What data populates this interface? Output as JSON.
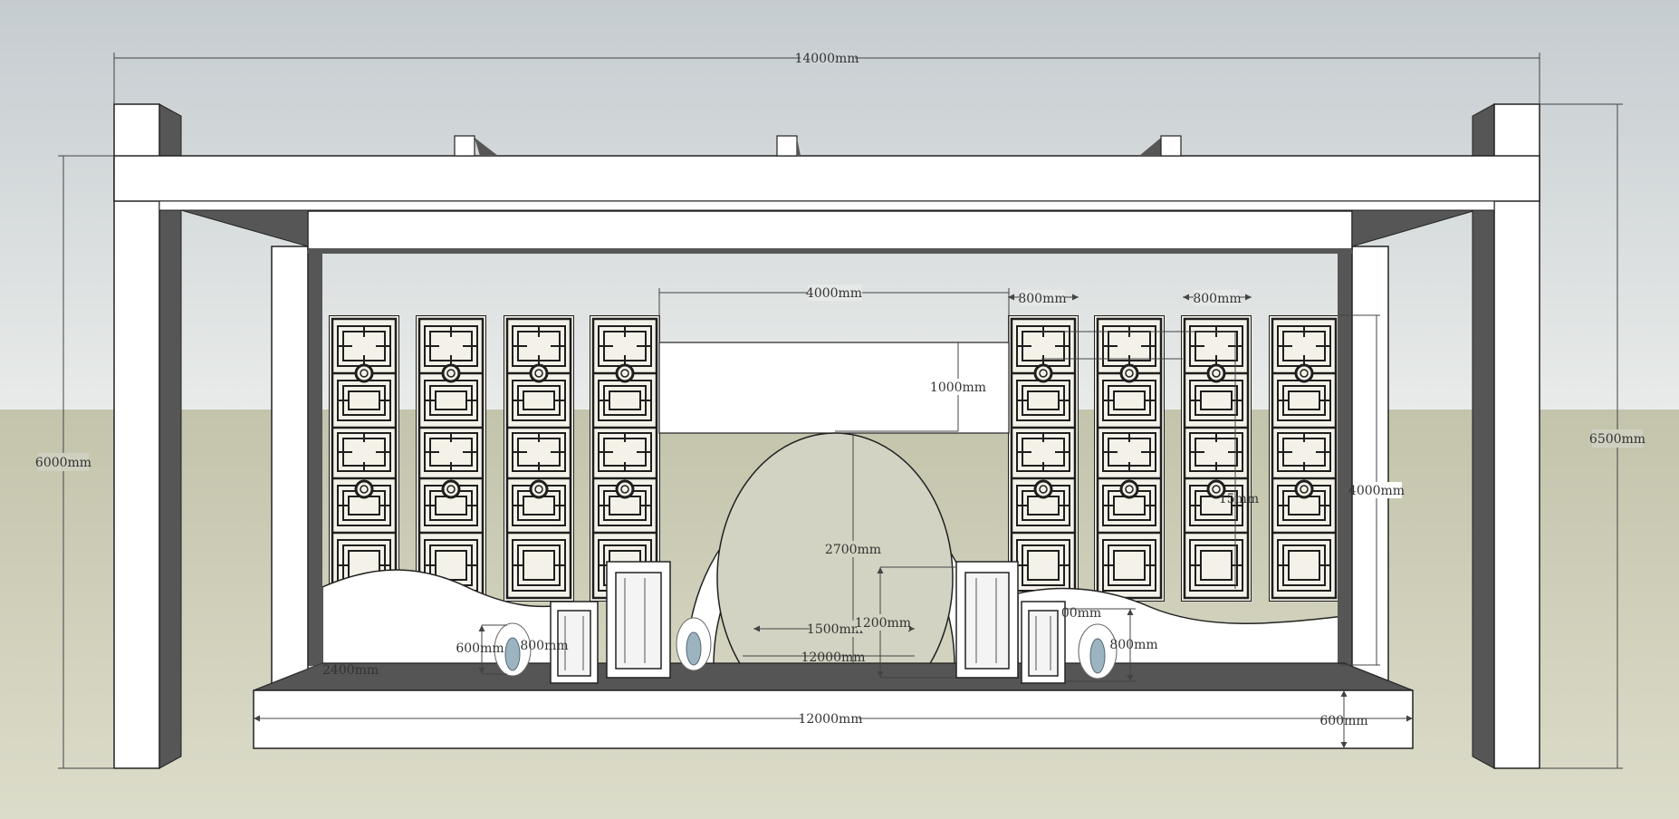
{
  "colors": {
    "sky_top": "#c5ccd0",
    "sky_bottom": "#e8ebe9",
    "ground_top": "#c4c4ac",
    "ground_bottom": "#dcdcca",
    "structure_white": "#ffffff",
    "structure_shadow": "#565656",
    "stage_top": "#555555",
    "edge": "#222222",
    "lattice_line": "#1e1e1e",
    "lattice_fill": "#f4f2e8",
    "vase_glass": "#9cb4c0"
  },
  "dimensions": {
    "overall_width": "14000mm",
    "left_height": "6000mm",
    "right_height": "6500mm",
    "stage_width": "12000mm",
    "stage_height": "600mm",
    "stage_depth": "2400mm",
    "wall_width": "4000mm",
    "wall_top_band": "1000mm",
    "arch_height": "2700mm",
    "arch_base_width": "1500mm",
    "arch_inner_base": "12000mm",
    "lantern_height": "1200mm",
    "panel_width_left": "800mm",
    "panel_width_right": "800mm",
    "screen_height": "4000mm",
    "panel_partial": "15mm",
    "vase_height_left": "600mm",
    "vase_width_left": "800mm",
    "vase_width_right_partial": "00mm",
    "vase_height_right": "800mm"
  }
}
